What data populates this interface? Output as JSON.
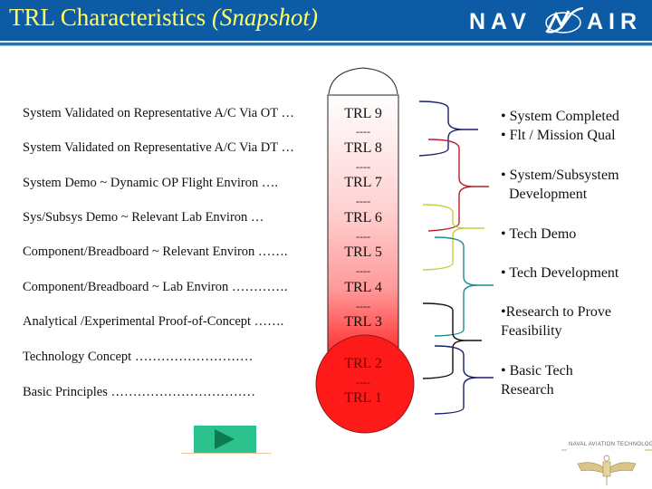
{
  "header": {
    "title_main": "TRL Characteristics ",
    "title_italic": "(Snapshot)",
    "logo_left": "NAV",
    "logo_right": "AIR",
    "logo_icon": "navair-swoosh-icon"
  },
  "levels": [
    {
      "description": "System Validated on Representative A/C Via OT …",
      "trl": "TRL 9"
    },
    {
      "description": "System Validated on Representative A/C Via DT …",
      "trl": "TRL 8"
    },
    {
      "description": "System Demo ~ Dynamic OP Flight Environ ….",
      "trl": "TRL 7"
    },
    {
      "description": "Sys/Subsys Demo ~ Relevant Lab Environ …",
      "trl": "TRL 6"
    },
    {
      "description": "Component/Breadboard ~ Relevant Environ …….",
      "trl": "TRL 5"
    },
    {
      "description": "Component/Breadboard ~ Lab Environ ………….",
      "trl": "TRL 4"
    },
    {
      "description": "Analytical /Experimental  Proof-of-Concept …….",
      "trl": "TRL 3"
    },
    {
      "description": "Technology Concept ………………………",
      "trl": "TRL 2"
    },
    {
      "description": "Basic Principles ……………………………",
      "trl": "TRL 1"
    }
  ],
  "separator": "----",
  "groups": [
    {
      "lines": [
        "• System Completed",
        "• Flt / Mission Qual"
      ],
      "color": "#1a1f6e"
    },
    {
      "lines": [
        "• System/Subsystem",
        "  Development"
      ],
      "color": "#b8202a"
    },
    {
      "lines": [
        "• Tech Demo"
      ],
      "color": "#c8cf3a"
    },
    {
      "lines": [
        "• Tech Development"
      ],
      "color": "#1f8a8a"
    },
    {
      "lines": [
        "•Research to Prove",
        "Feasibility"
      ],
      "color": "#111111"
    },
    {
      "lines": [
        "• Basic Tech",
        "Research"
      ],
      "color": "#1a1f6e"
    }
  ],
  "navigation": {
    "play_icon": "play-icon"
  },
  "footer": {
    "emblem_text": "NAVAL AVIATION TECHNOLOGIES"
  },
  "colors": {
    "header_bg": "#0d5aa5",
    "title": "#ffff66",
    "bulb": "#ff1a1a",
    "button": "#2cc28e"
  }
}
